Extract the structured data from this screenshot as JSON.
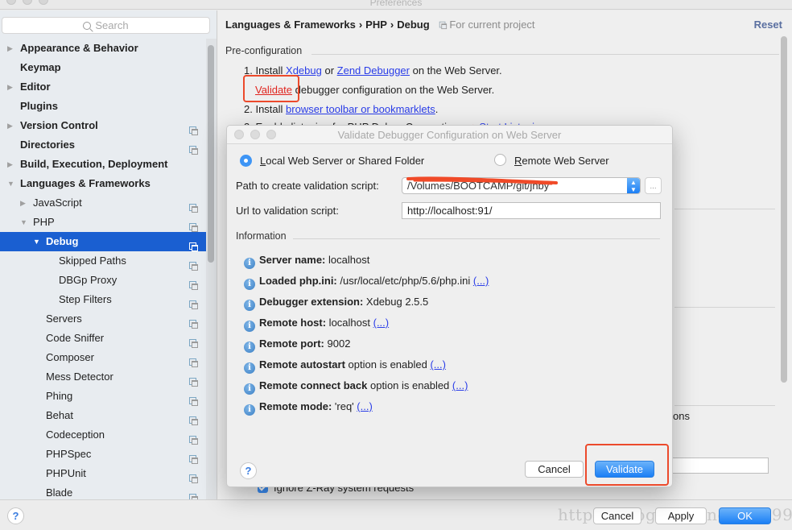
{
  "window": {
    "title": "Preferences"
  },
  "sidebar": {
    "search_placeholder": "Search",
    "items": [
      {
        "label": "Appearance & Behavior",
        "level": 0,
        "bold": true,
        "arrow": "right",
        "project": false
      },
      {
        "label": "Keymap",
        "level": 0,
        "bold": true,
        "arrow": "none",
        "project": false
      },
      {
        "label": "Editor",
        "level": 0,
        "bold": true,
        "arrow": "right",
        "project": false
      },
      {
        "label": "Plugins",
        "level": 0,
        "bold": true,
        "arrow": "none",
        "project": false
      },
      {
        "label": "Version Control",
        "level": 0,
        "bold": true,
        "arrow": "right",
        "project": true
      },
      {
        "label": "Directories",
        "level": 0,
        "bold": true,
        "arrow": "none",
        "project": true
      },
      {
        "label": "Build, Execution, Deployment",
        "level": 0,
        "bold": true,
        "arrow": "right",
        "project": false
      },
      {
        "label": "Languages & Frameworks",
        "level": 0,
        "bold": true,
        "arrow": "down",
        "project": false
      },
      {
        "label": "JavaScript",
        "level": 1,
        "bold": false,
        "arrow": "right",
        "project": true
      },
      {
        "label": "PHP",
        "level": 1,
        "bold": false,
        "arrow": "down",
        "project": true
      },
      {
        "label": "Debug",
        "level": 2,
        "bold": true,
        "arrow": "down",
        "project": true,
        "selected": true
      },
      {
        "label": "Skipped Paths",
        "level": 3,
        "bold": false,
        "arrow": "none",
        "project": true
      },
      {
        "label": "DBGp Proxy",
        "level": 3,
        "bold": false,
        "arrow": "none",
        "project": true
      },
      {
        "label": "Step Filters",
        "level": 3,
        "bold": false,
        "arrow": "none",
        "project": true
      },
      {
        "label": "Servers",
        "level": 2,
        "bold": false,
        "arrow": "none",
        "project": true
      },
      {
        "label": "Code Sniffer",
        "level": 2,
        "bold": false,
        "arrow": "none",
        "project": true
      },
      {
        "label": "Composer",
        "level": 2,
        "bold": false,
        "arrow": "none",
        "project": true
      },
      {
        "label": "Mess Detector",
        "level": 2,
        "bold": false,
        "arrow": "none",
        "project": true
      },
      {
        "label": "Phing",
        "level": 2,
        "bold": false,
        "arrow": "none",
        "project": true
      },
      {
        "label": "Behat",
        "level": 2,
        "bold": false,
        "arrow": "none",
        "project": true
      },
      {
        "label": "Codeception",
        "level": 2,
        "bold": false,
        "arrow": "none",
        "project": true
      },
      {
        "label": "PHPSpec",
        "level": 2,
        "bold": false,
        "arrow": "none",
        "project": true
      },
      {
        "label": "PHPUnit",
        "level": 2,
        "bold": false,
        "arrow": "none",
        "project": true
      },
      {
        "label": "Blade",
        "level": 2,
        "bold": false,
        "arrow": "none",
        "project": true
      }
    ]
  },
  "main": {
    "breadcrumb": [
      "Languages & Frameworks",
      "PHP",
      "Debug"
    ],
    "breadcrumb_separator": "›",
    "scope": "For current project",
    "reset_label": "Reset",
    "preconfig_title": "Pre-configuration",
    "step1": {
      "prefix": "1. Install ",
      "link1": "Xdebug",
      "middle": " or ",
      "link2": "Zend Debugger",
      "suffix": " on the Web Server."
    },
    "validate_line": {
      "link": "Validate",
      "suffix": " debugger configuration on the Web Server."
    },
    "step2": {
      "prefix": "2. Install ",
      "link": "browser toolbar or bookmarklets",
      "suffix": "."
    },
    "step3": {
      "text": "3. Enable listening for PHP Debug Connections:",
      "link": "Start Listening"
    },
    "partial_text_right": "ons",
    "ignore_zray_label": "Ignore Z-Ray system requests",
    "ignore_zray_checked": true
  },
  "dialog": {
    "title": "Validate Debugger Configuration on Web Server",
    "radio_local": {
      "label": "Local Web Server or Shared Folder",
      "mnemonic": "L",
      "rest": "ocal Web Server or Shared Folder",
      "selected": true
    },
    "radio_remote": {
      "label": "Remote Web Server",
      "mnemonic": "R",
      "rest": "emote Web Server",
      "selected": false
    },
    "path_label": "Path to create validation script:",
    "path_value": "/Volumes/BOOTCAMP/git/jhby",
    "browse_label": "...",
    "url_label": "Url to validation script:",
    "url_value": "http://localhost:91/",
    "info_title": "Information",
    "info": [
      {
        "bold": "Server name:",
        "text": " localhost",
        "link": ""
      },
      {
        "bold": "Loaded php.ini:",
        "text": " /usr/local/etc/php/5.6/php.ini ",
        "link": "(...)"
      },
      {
        "bold": "Debugger extension:",
        "text": " Xdebug 2.5.5",
        "link": ""
      },
      {
        "bold": "Remote host:",
        "text": " localhost ",
        "link": "(...)"
      },
      {
        "bold": "Remote port:",
        "text": " 9002",
        "link": ""
      },
      {
        "bold": "Remote autostart",
        "text": " option is enabled ",
        "link": "(...)"
      },
      {
        "bold": "Remote connect back",
        "text": " option is enabled ",
        "link": "(...)"
      },
      {
        "bold": "Remote mode:",
        "text": " 'req' ",
        "link": "(...)"
      }
    ],
    "help_label": "?",
    "cancel_label": "Cancel",
    "validate_label": "Validate"
  },
  "footer": {
    "help_label": "?",
    "cancel_label": "Cancel",
    "apply_label": "Apply",
    "ok_label": "OK",
    "watermark": "https://blog.csdn.net/LT1993"
  },
  "colors": {
    "selection": "#1a5fd1",
    "link": "#2a3de8",
    "annotation_red": "#ec4a2c",
    "primary_button": "#1b7ff5"
  }
}
